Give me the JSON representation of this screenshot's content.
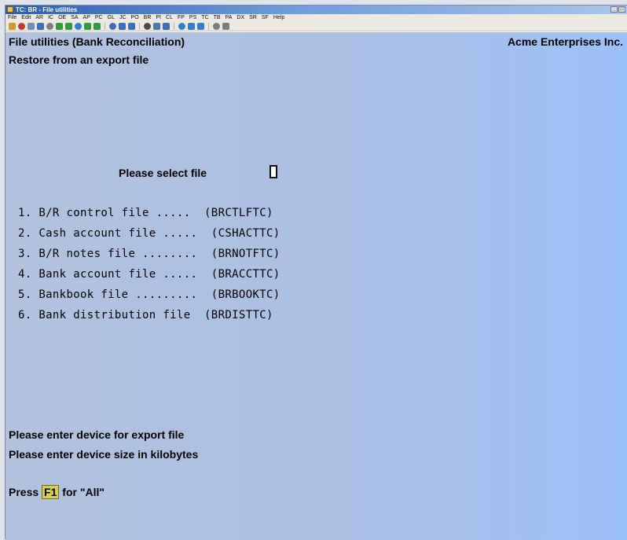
{
  "window": {
    "title": "TC: BR - File utilities"
  },
  "menubar": {
    "items": [
      "File",
      "Edit",
      "AR",
      "IC",
      "OE",
      "SA",
      "AP",
      "PC",
      "GL",
      "JC",
      "PO",
      "BR",
      "PI",
      "CL",
      "FP",
      "PS",
      "TC",
      "TB",
      "PA",
      "DX",
      "SR",
      "SF",
      "Help"
    ]
  },
  "toolbar": {
    "icons": [
      {
        "name": "open-icon",
        "color": "#d09a2a"
      },
      {
        "name": "stop-icon",
        "color": "#c0392b"
      },
      {
        "name": "find-icon",
        "color": "#6f8fb8"
      },
      {
        "name": "settings-icon",
        "color": "#3a6fc0"
      },
      {
        "name": "print-icon",
        "color": "#7d7d7d"
      },
      {
        "name": "check-icon",
        "color": "#2f9b3a"
      },
      {
        "name": "cancel-icon",
        "color": "#2f9b3a"
      },
      {
        "name": "undo-icon",
        "color": "#2f7fd0"
      },
      {
        "name": "up-arrow-icon",
        "color": "#2f9b3a"
      },
      {
        "name": "down-arrow-icon",
        "color": "#2f9b3a"
      },
      {
        "name": "first-icon",
        "color": "#3a6fc0"
      },
      {
        "name": "prev-icon",
        "color": "#3a6fc0"
      },
      {
        "name": "next-icon",
        "color": "#3a6fc0"
      },
      {
        "name": "binoculars-icon",
        "color": "#4a4a4a"
      },
      {
        "name": "zoom-icon",
        "color": "#4a78b0"
      },
      {
        "name": "refresh-icon",
        "color": "#3a6fc0"
      },
      {
        "name": "back-icon",
        "color": "#2f7fd0"
      },
      {
        "name": "forward-icon",
        "color": "#2f7fd0"
      },
      {
        "name": "help-icon",
        "color": "#2f7fd0"
      },
      {
        "name": "calculator-icon",
        "color": "#7d7d7d"
      },
      {
        "name": "notes-icon",
        "color": "#7d7d7d"
      }
    ]
  },
  "screen": {
    "heading": "File utilities (Bank Reconciliation)",
    "company": "Acme Enterprises Inc.",
    "subheading": "Restore from an export file",
    "select_prompt": "Please select file",
    "files": [
      "1. B/R control file .....  (BRCTLFTC)",
      "2. Cash account file .....  (CSHACTTC)",
      "3. B/R notes file ........  (BRNOTFTC)",
      "4. Bank account file .....  (BRACCTTC)",
      "5. Bankbook file .........  (BRBOOKTC)",
      "6. Bank distribution file  (BRDISTTC)"
    ],
    "device_prompt": "Please enter device for export file",
    "size_prompt": "Please enter device size in kilobytes",
    "press_prefix": "Press ",
    "press_key": "F1",
    "press_suffix": " for \"All\""
  }
}
